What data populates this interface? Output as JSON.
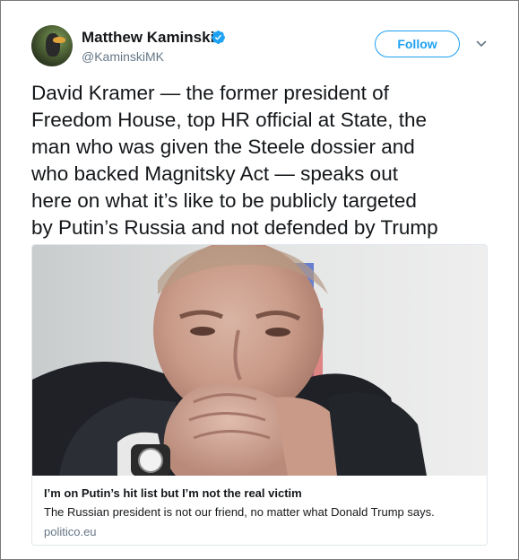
{
  "author": {
    "name": "Matthew Kaminski",
    "handle": "@KaminskiMK",
    "verified": true
  },
  "follow_label": "Follow",
  "tweet_text": "David Kramer — the former president of\nFreedom House, top HR official at State, the\nman who was given the Steele dossier and\nwho backed Magnitsky Act — speaks out\nhere on what it’s like to be publicly targeted\nby Putin’s Russia and not defended by Trump",
  "card": {
    "title": "I’m on Putin’s hit list but I’m not the real victim",
    "description": "The Russian president is not our friend, no matter what Donald Trump says.",
    "domain": "politico.eu"
  },
  "colors": {
    "accent": "#1da1f2",
    "secondary_text": "#657786",
    "primary_text": "#14171a"
  },
  "icons": {
    "verified": "verified-badge-icon",
    "menu": "chevron-down-icon"
  }
}
